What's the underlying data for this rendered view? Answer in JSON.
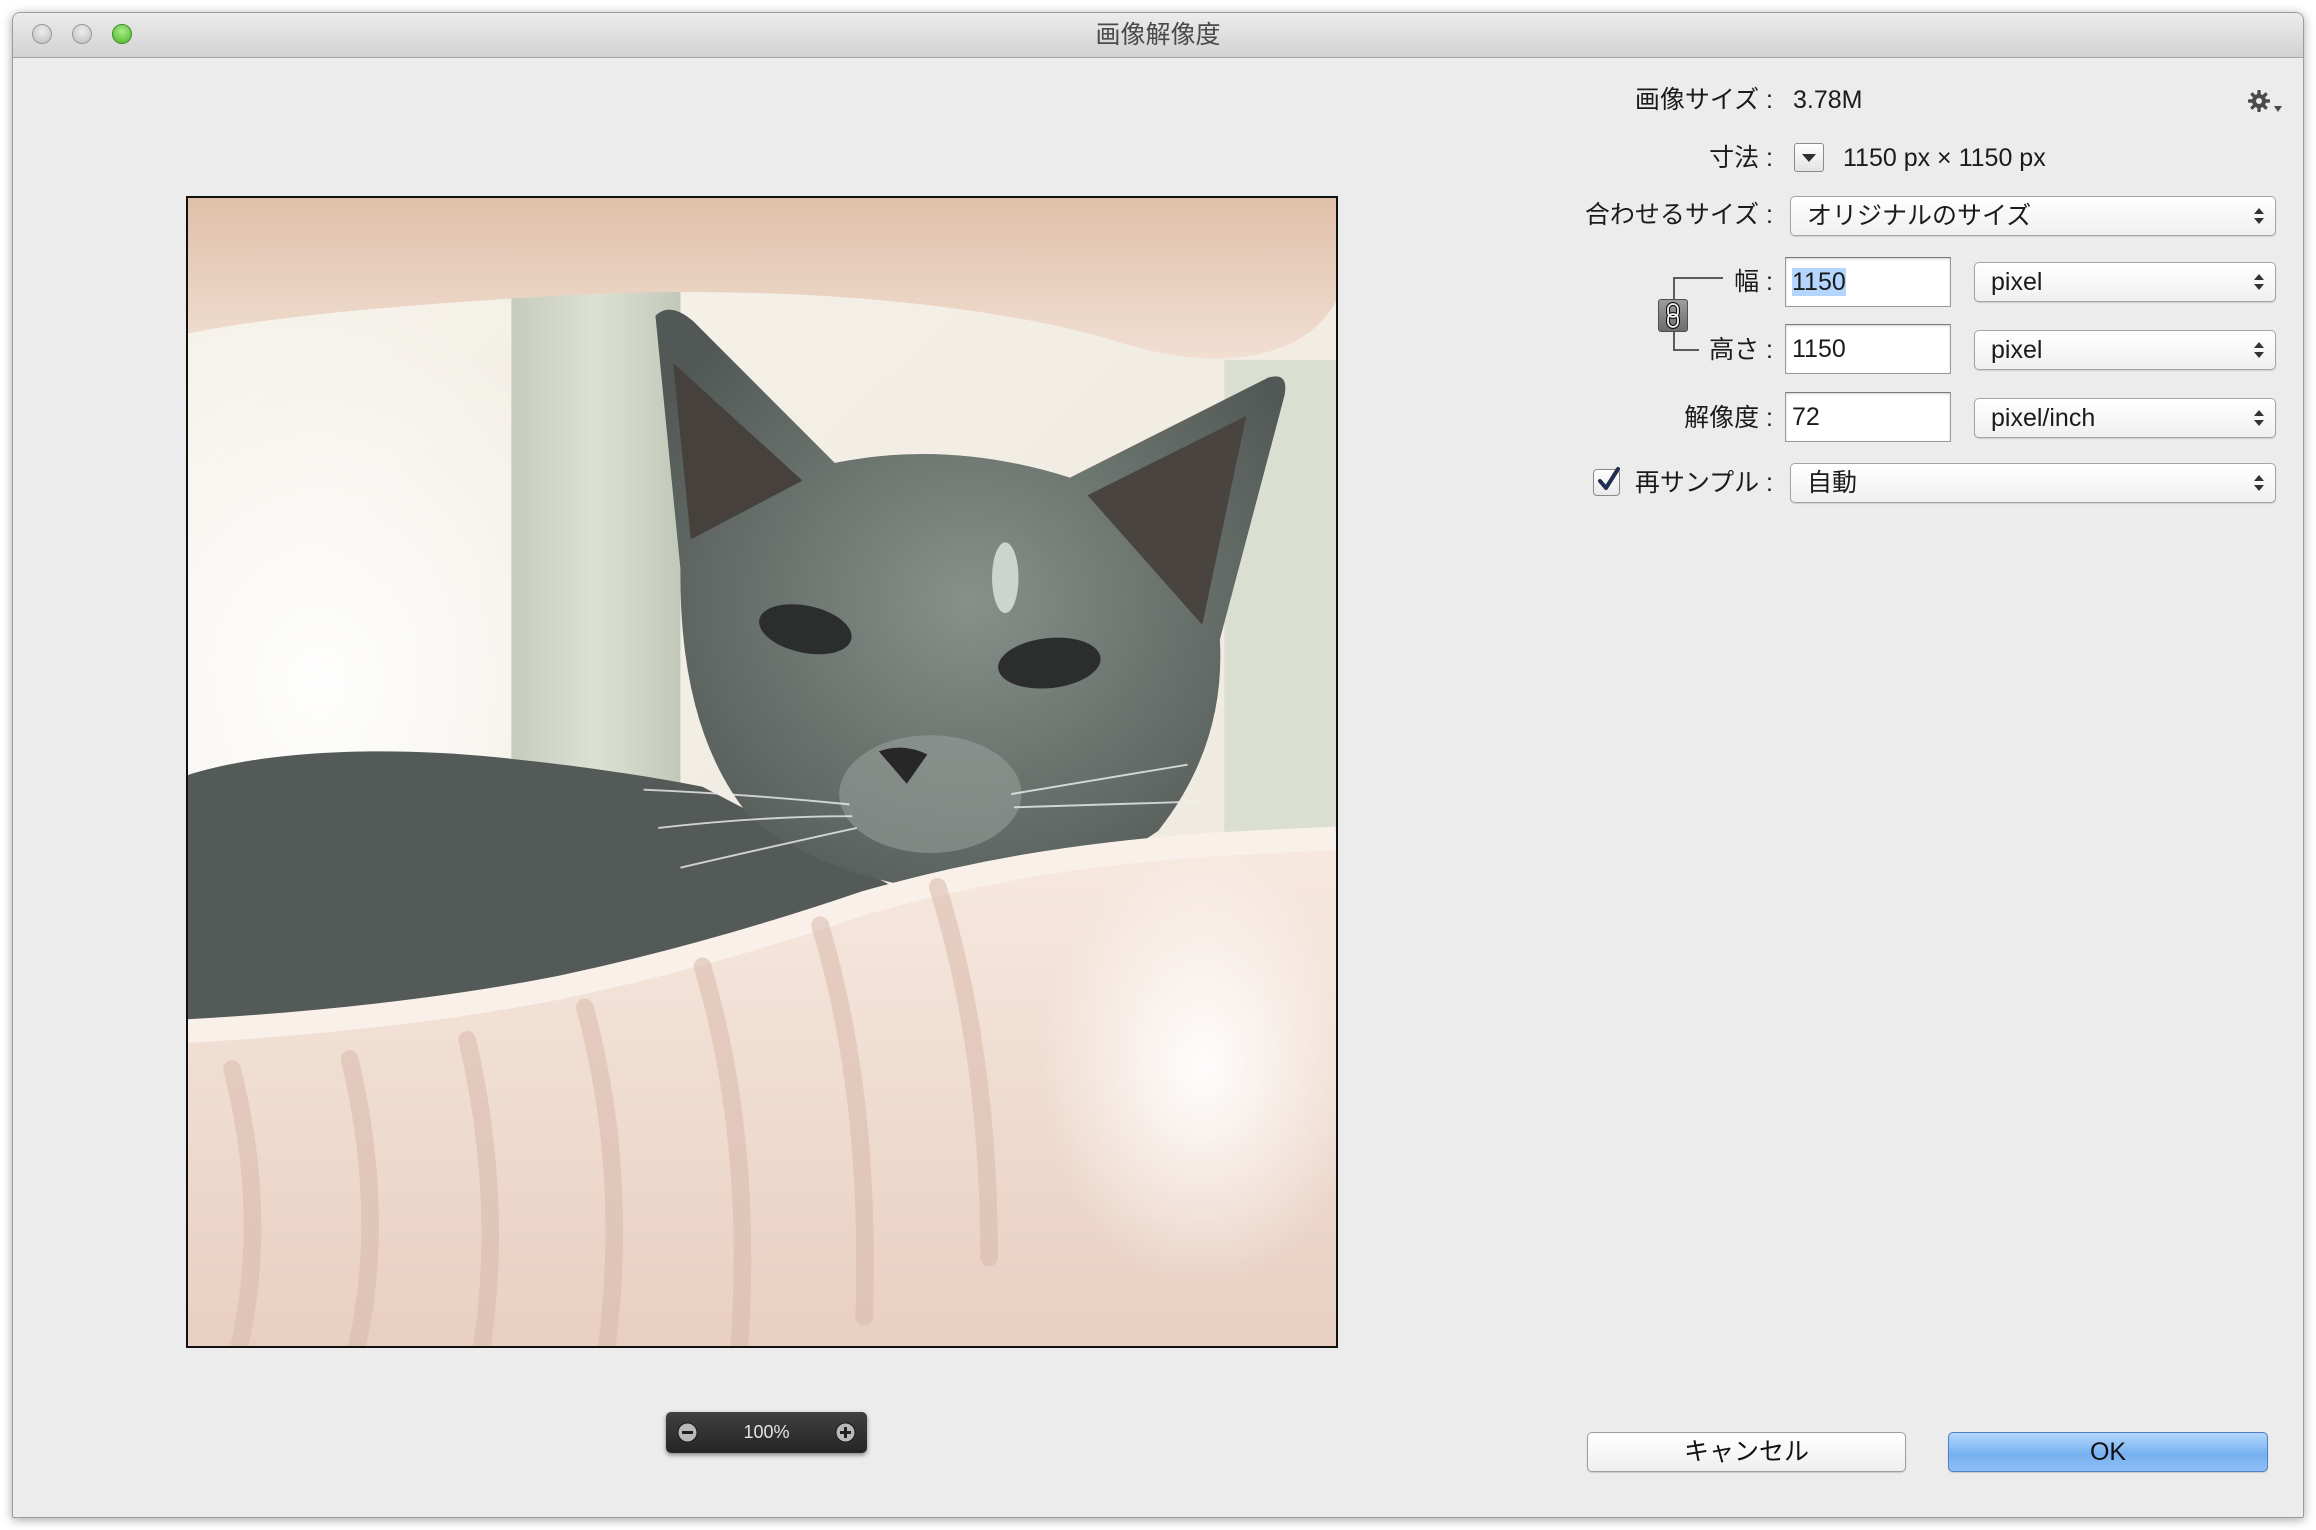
{
  "window": {
    "title": "画像解像度"
  },
  "preview": {
    "zoom_level": "100%"
  },
  "settings": {
    "image_size": {
      "label": "画像サイズ :",
      "value": "3.78M"
    },
    "dimensions": {
      "label": "寸法 :",
      "value": "1150 px × 1150 px"
    },
    "fit_to": {
      "label": "合わせるサイズ :",
      "value": "オリジナルのサイズ"
    },
    "width": {
      "label": "幅 :",
      "value": "1150",
      "unit": "pixel",
      "text_selected": true
    },
    "height": {
      "label": "高さ :",
      "value": "1150",
      "unit": "pixel"
    },
    "resolution": {
      "label": "解像度 :",
      "value": "72",
      "unit": "pixel/inch"
    },
    "constrain_proportions": {
      "linked": true
    },
    "resample": {
      "label": "再サンプル :",
      "checked": true,
      "value": "自動"
    }
  },
  "buttons": {
    "cancel": "キャンセル",
    "ok": "OK"
  },
  "icons": {
    "settings": "gear-icon",
    "dimensions_menu": "disclosure-triangle-icon",
    "constrain": "link-icon",
    "zoom_out": "zoom-out-icon",
    "zoom_in": "zoom-in-icon",
    "popup_arrows": "up-down-arrows-icon",
    "checkmark": "checkmark-icon"
  },
  "colors": {
    "window_background": "#ececec",
    "ok_button": "#77b1f2",
    "selection_highlight": "#b4d5fe",
    "zoom_light": "#4db42a",
    "inactive_light": "#bcbcbc"
  }
}
